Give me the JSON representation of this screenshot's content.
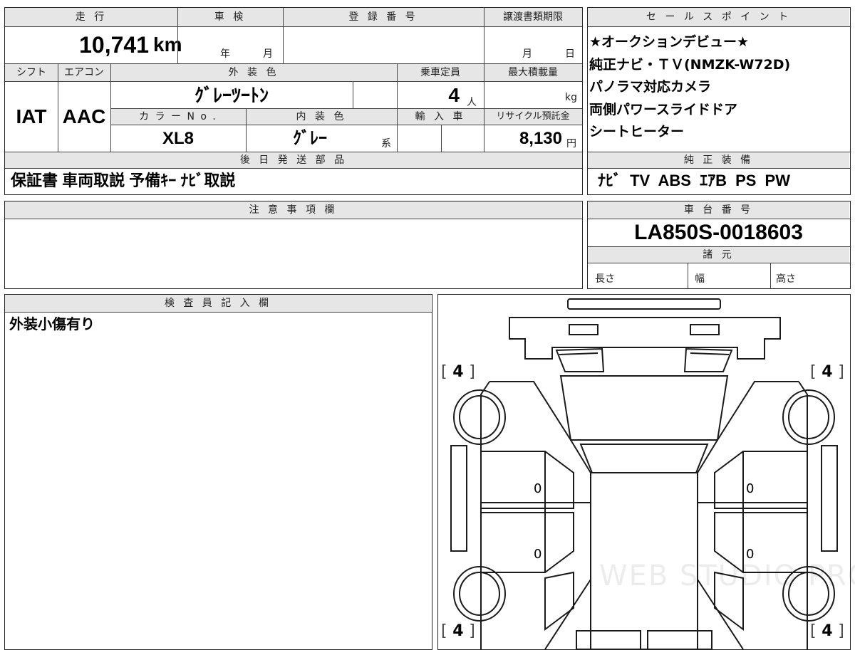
{
  "main_table": {
    "mileage_header": "走 行",
    "inspection_header": "車 検",
    "registration_header": "登 録 番 号",
    "transfer_deadline_header": "譲渡書類期限",
    "mileage_value": "10,741",
    "mileage_unit": "km",
    "inspection_year": "年",
    "inspection_month": "月",
    "transfer_month": "月",
    "transfer_day": "日",
    "shift_header": "シフト",
    "aircon_header": "エアコン",
    "exterior_color_header": "外 装 色",
    "capacity_header": "乗車定員",
    "max_load_header": "最大積載量",
    "shift_value": "IAT",
    "aircon_value": "AAC",
    "exterior_color_value": "ｸﾞﾚｰﾂｰﾄﾝ",
    "capacity_value": "4",
    "capacity_unit": "人",
    "max_load_unit": "kg",
    "color_no_header": "カ ラ ー N o .",
    "interior_color_header": "内 装 色",
    "import_header": "輸 入 車",
    "recycle_header": "リサイクル預託金",
    "color_no_value": "XL8",
    "interior_color_value": "ｸﾞﾚｰ",
    "interior_color_suffix": "系",
    "recycle_value": "8,130",
    "recycle_unit": "円",
    "later_parts_header": "後 日 発 送 部 品",
    "later_parts_value": "保証書 車両取説 予備ｷｰ ﾅﾋﾞ取説"
  },
  "sales_points": {
    "header": "セ ー ル ス ポ イ ン ト",
    "lines": [
      "★オークションデビュー★",
      "純正ナビ・ＴＶ(NMZK-W72D)",
      "パノラマ対応カメラ",
      "両側パワースライドドア",
      "シートヒーター"
    ]
  },
  "standard_equipment": {
    "header": "純 正 装 備",
    "value": "ﾅﾋﾞ TV ABS ｴｱB PS PW"
  },
  "notes": {
    "header": "注 意 事 項 欄",
    "value": ""
  },
  "chassis": {
    "header": "車 台 番 号",
    "value": "LA850S-0018603",
    "specs_header": "諸 元",
    "length_label": "長さ",
    "width_label": "幅",
    "height_label": "高さ"
  },
  "inspector": {
    "header": "検 査 員 記 入 欄",
    "comment": "外装小傷有り"
  },
  "diagram": {
    "tire_tl": "4",
    "tire_tr": "4",
    "tire_bl": "4",
    "tire_br": "4",
    "bracket_open": "[",
    "bracket_close": "]",
    "panel_left_front": "0",
    "panel_left_rear": "0",
    "panel_right_front": "0",
    "panel_right_rear": "0",
    "watermark": "WEB STUDIO PRO"
  }
}
